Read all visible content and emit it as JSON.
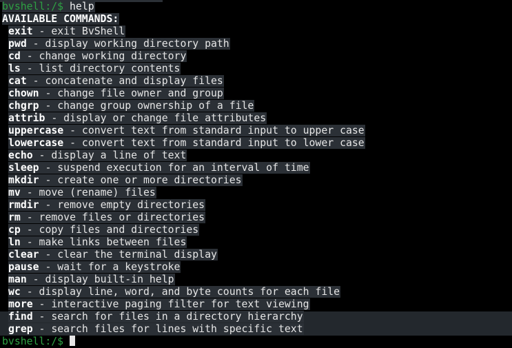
{
  "prompt": "bvshell:/$ ",
  "typed_command": "help",
  "header": "AVAILABLE COMMANDS:",
  "commands": [
    {
      "name": "exit",
      "desc": " - exit BvShell"
    },
    {
      "name": "pwd",
      "desc": " - display working directory path"
    },
    {
      "name": "cd",
      "desc": " - change working directory"
    },
    {
      "name": "ls",
      "desc": " - list directory contents"
    },
    {
      "name": "cat",
      "desc": " - concatenate and display files"
    },
    {
      "name": "chown",
      "desc": " - change file owner and group"
    },
    {
      "name": "chgrp",
      "desc": " - change group ownership of a file"
    },
    {
      "name": "attrib",
      "desc": " - display or change file attributes"
    },
    {
      "name": "uppercase",
      "desc": " - convert text from standard input to upper case"
    },
    {
      "name": "lowercase",
      "desc": " - convert text from standard input to lower case"
    },
    {
      "name": "echo",
      "desc": " - display a line of text"
    },
    {
      "name": "sleep",
      "desc": " - suspend execution for an interval of time"
    },
    {
      "name": "mkdir",
      "desc": " - create one or more directories"
    },
    {
      "name": "mv",
      "desc": " - move (rename) files"
    },
    {
      "name": "rmdir",
      "desc": " - remove empty directories"
    },
    {
      "name": "rm",
      "desc": " - remove files or directories"
    },
    {
      "name": "cp",
      "desc": " - copy files and directories"
    },
    {
      "name": "ln",
      "desc": " - make links between files"
    },
    {
      "name": "clear",
      "desc": " - clear the terminal display"
    },
    {
      "name": "pause",
      "desc": " - wait for a keystroke"
    },
    {
      "name": "man",
      "desc": " - display built-in help"
    },
    {
      "name": "wc",
      "desc": " - display line, word, and byte counts for each file"
    },
    {
      "name": "more",
      "desc": " - interactive paging filter for text viewing"
    },
    {
      "name": "find",
      "desc": " - search for files in a directory hierarchy"
    },
    {
      "name": "grep",
      "desc": " - search files for lines with specific text"
    }
  ],
  "final_prompt": "bvshell:/$ ",
  "colors": {
    "background": "#000000",
    "prompt": "#2ea043",
    "highlight": "#2b3036",
    "text": "#e6e6e6"
  }
}
